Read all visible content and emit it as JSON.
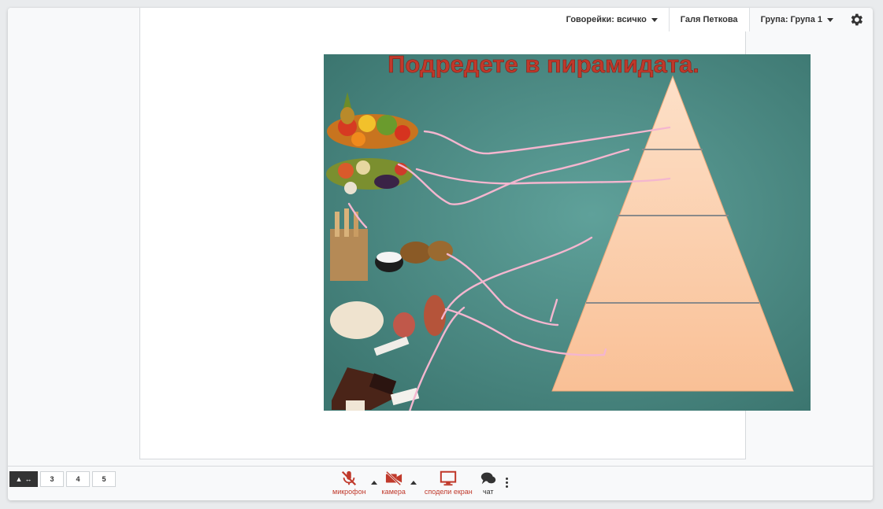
{
  "topbar": {
    "speakers_label": "Говорейки: всичко",
    "user_name": "Галя Петкова",
    "group_label": "Група: Група 1"
  },
  "slide": {
    "title": "Подредете в пирамидата."
  },
  "pages": {
    "items": [
      "3",
      "4",
      "5"
    ]
  },
  "controls": {
    "mic_label": "микрофон",
    "camera_label": "камера",
    "share_label": "сподели екран",
    "chat_label": "чат"
  },
  "colors": {
    "accent_red": "#c0392b",
    "slide_bg": "#4f8e88",
    "pyramid": "#fbcda6",
    "annotation": "#f4b6cf"
  }
}
